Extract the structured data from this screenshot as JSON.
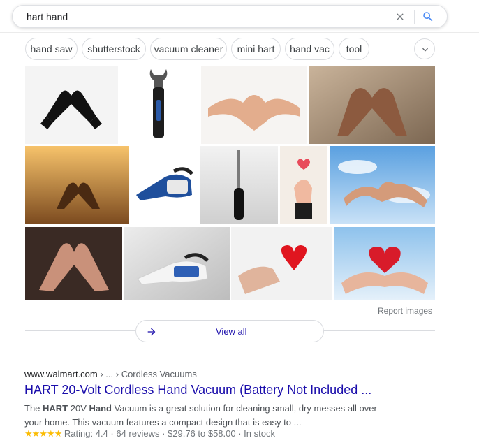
{
  "search": {
    "query": "hart hand"
  },
  "chips": [
    "hand saw",
    "shutterstock",
    "vacuum cleaner",
    "mini hart",
    "hand vac",
    "tool"
  ],
  "images": {
    "report_label": "Report images",
    "view_all_label": "View all"
  },
  "result": {
    "cite_domain": "www.walmart.com",
    "cite_path": " › ... › Cordless Vacuums",
    "title": "HART 20-Volt Cordless Hand Vacuum (Battery Not Included ...",
    "snippet_parts": [
      "The ",
      "HART",
      " 20V ",
      "Hand",
      " Vacuum is a great solution for cleaning small, dry messes all over your home. This vacuum features a compact design that is easy to ..."
    ],
    "stars": "★★★★★",
    "rating_text": "Rating: 4.4 · 64 reviews · $29.76 to $58.00 · In stock"
  },
  "colors": {
    "link": "#1a0dab",
    "accent": "#4285f4",
    "star": "#fbbc04"
  }
}
